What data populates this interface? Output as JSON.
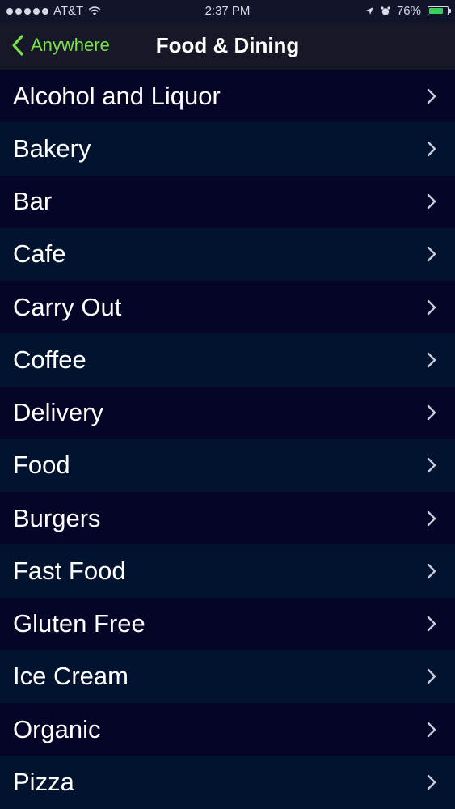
{
  "status_bar": {
    "carrier": "AT&T",
    "time": "2:37 PM",
    "battery": "76%",
    "battery_level": 0.76,
    "battery_color": "#34d058"
  },
  "nav": {
    "back_label": "Anywhere",
    "title": "Food & Dining",
    "accent_color": "#7be04b"
  },
  "categories": [
    {
      "label": "Alcohol and Liquor"
    },
    {
      "label": "Bakery"
    },
    {
      "label": "Bar"
    },
    {
      "label": "Cafe"
    },
    {
      "label": "Carry Out"
    },
    {
      "label": "Coffee"
    },
    {
      "label": "Delivery"
    },
    {
      "label": "Food"
    },
    {
      "label": "Burgers"
    },
    {
      "label": "Fast Food"
    },
    {
      "label": "Gluten Free"
    },
    {
      "label": "Ice Cream"
    },
    {
      "label": "Organic"
    },
    {
      "label": "Pizza"
    }
  ],
  "icons": {
    "back": "chevron-left-icon",
    "row": "chevron-right-icon",
    "wifi": "wifi-icon",
    "location": "location-arrow-icon",
    "alarm": "alarm-icon",
    "battery": "battery-icon"
  }
}
